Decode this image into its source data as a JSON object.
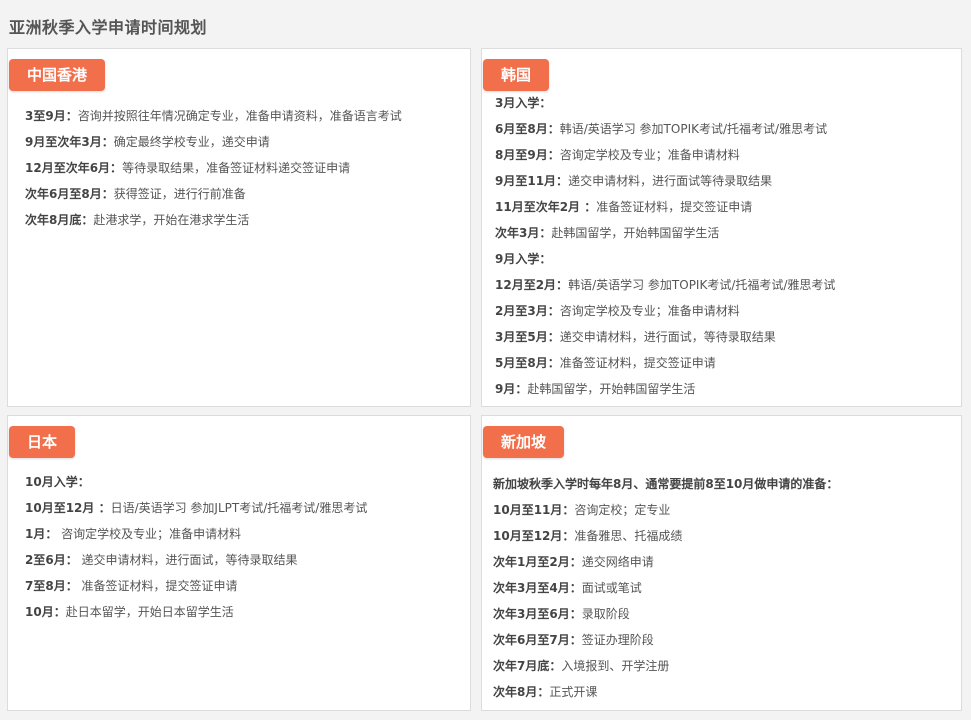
{
  "page": {
    "title": "亚洲秋季入学申请时间规划"
  },
  "sections": {
    "hk": {
      "tag": "中国香港",
      "items": [
        {
          "k": "3至9月：",
          "v": "咨询并按照往年情况确定专业，准备申请资料，准备语言考试"
        },
        {
          "k": "9月至次年3月：",
          "v": "确定最终学校专业，递交申请"
        },
        {
          "k": "12月至次年6月：",
          "v": "等待录取结果，准备签证材料递交签证申请"
        },
        {
          "k": "次年6月至8月：",
          "v": "获得签证，进行行前准备"
        },
        {
          "k": "次年8月底：",
          "v": "赴港求学，开始在港求学生活"
        }
      ]
    },
    "kr": {
      "tag": "韩国",
      "items": [
        {
          "k": "3月入学：",
          "v": ""
        },
        {
          "k": "6月至8月：",
          "v": "韩语/英语学习 参加TOPIK考试/托福考试/雅思考试"
        },
        {
          "k": "8月至9月：",
          "v": "咨询定学校及专业；准备申请材料"
        },
        {
          "k": "9月至11月：",
          "v": "递交申请材料，进行面试等待录取结果"
        },
        {
          "k": "11月至次年2月 ：",
          "v": "准备签证材料，提交签证申请"
        },
        {
          "k": "次年3月：",
          "v": "赴韩国留学，开始韩国留学生活"
        },
        {
          "k": "9月入学：",
          "v": ""
        },
        {
          "k": "12月至2月：",
          "v": "韩语/英语学习 参加TOPIK考试/托福考试/雅思考试"
        },
        {
          "k": "2月至3月：",
          "v": "咨询定学校及专业；准备申请材料"
        },
        {
          "k": "3月至5月：",
          "v": "递交申请材料，进行面试，等待录取结果"
        },
        {
          "k": "5月至8月：",
          "v": "准备签证材料，提交签证申请"
        },
        {
          "k": "9月：",
          "v": "赴韩国留学，开始韩国留学生活"
        }
      ]
    },
    "jp": {
      "tag": "日本",
      "items": [
        {
          "k": "10月入学：",
          "v": ""
        },
        {
          "k": "10月至12月 ：",
          "v": "日语/英语学习 参加JLPT考试/托福考试/雅思考试"
        },
        {
          "k": "1月：",
          "v": " 咨询定学校及专业；准备申请材料"
        },
        {
          "k": "2至6月：",
          "v": " 递交申请材料，进行面试，等待录取结果"
        },
        {
          "k": "7至8月：",
          "v": " 准备签证材料，提交签证申请"
        },
        {
          "k": "10月：",
          "v": "赴日本留学，开始日本留学生活"
        }
      ]
    },
    "sg": {
      "tag": "新加坡",
      "items": [
        {
          "k": "新加坡秋季入学时每年8月、通常要提前8至10月做申请的准备：",
          "v": ""
        },
        {
          "k": "10月至11月：",
          "v": "咨询定校；定专业"
        },
        {
          "k": "10月至12月：",
          "v": "准备雅思、托福成绩"
        },
        {
          "k": "次年1月至2月：",
          "v": "递交网络申请"
        },
        {
          "k": "次年3月至4月：",
          "v": "面试或笔试"
        },
        {
          "k": "次年3月至6月：",
          "v": "录取阶段"
        },
        {
          "k": "次年6月至7月：",
          "v": "签证办理阶段"
        },
        {
          "k": "次年7月底：",
          "v": "入境报到、开学注册"
        },
        {
          "k": "次年8月：",
          "v": "正式开课"
        }
      ]
    }
  },
  "colors": {
    "tag_bg": "#f26f4c",
    "page_bg": "#f3f3f4",
    "card_bg": "#ffffff"
  }
}
